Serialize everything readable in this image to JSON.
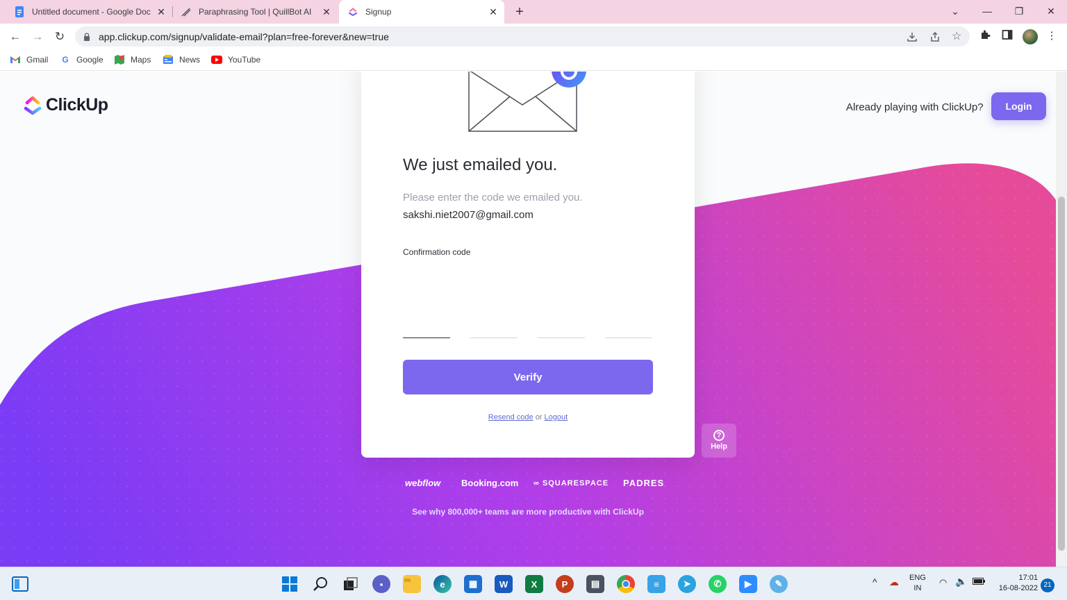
{
  "browser": {
    "tabs": [
      {
        "title": "Untitled document - Google Doc",
        "icon": "google-docs-icon",
        "active": false
      },
      {
        "title": "Paraphrasing Tool | QuillBot AI",
        "icon": "quillbot-icon",
        "active": false
      },
      {
        "title": "Signup",
        "icon": "clickup-icon",
        "active": true
      }
    ],
    "url": "app.clickup.com/signup/validate-email?plan=free-forever&new=true",
    "bookmarks": [
      {
        "label": "Gmail",
        "icon": "gmail-icon"
      },
      {
        "label": "Google",
        "icon": "google-icon"
      },
      {
        "label": "Maps",
        "icon": "maps-icon"
      },
      {
        "label": "News",
        "icon": "news-icon"
      },
      {
        "label": "YouTube",
        "icon": "youtube-icon"
      }
    ]
  },
  "page": {
    "logo_text": "ClickUp",
    "header_prompt": "Already playing with ClickUp?",
    "login_label": "Login",
    "card": {
      "heading": "We just emailed you.",
      "subtitle": "Please enter the code we emailed you.",
      "email": "sakshi.niet2007@gmail.com",
      "code_label": "Confirmation code",
      "verify_label": "Verify",
      "resend_label": "Resend code",
      "or_text": "or",
      "logout_label": "Logout"
    },
    "help_label": "Help",
    "brands": [
      "webflow",
      "Booking.com",
      "SQUARESPACE",
      "PADRES"
    ],
    "tagline": "See why 800,000+ teams are more productive with ClickUp"
  },
  "taskbar": {
    "lang": "ENG",
    "region": "IN",
    "time": "17:01",
    "date": "16-08-2022",
    "notifications": "21"
  },
  "colors": {
    "accent": "#7b68ee",
    "tabstrip": "#f4d3e3",
    "wave_start": "#7b3cf5",
    "wave_end": "#e64b9a"
  }
}
